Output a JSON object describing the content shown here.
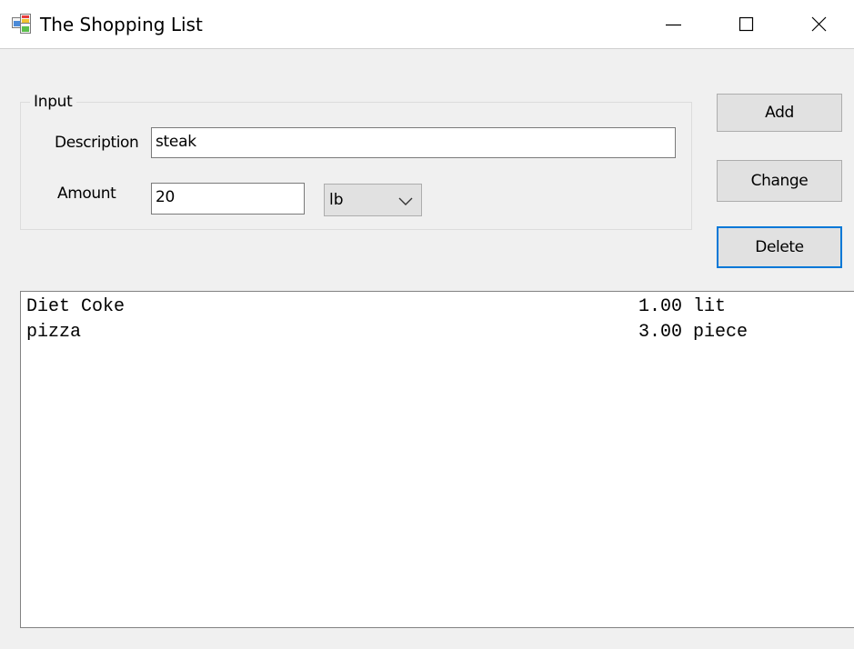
{
  "window": {
    "title": "The Shopping List",
    "app_icon": "winforms-app-icon",
    "controls": {
      "minimize_icon": "minimize-icon",
      "maximize_icon": "maximize-icon",
      "close_icon": "close-icon"
    }
  },
  "input_group": {
    "legend": "Input",
    "description_label": "Description",
    "description_value": "steak",
    "amount_label": "Amount",
    "amount_value": "20",
    "unit_selected": "lb",
    "unit_dropdown_icon": "chevron-down-icon"
  },
  "buttons": {
    "add": "Add",
    "change": "Change",
    "delete": "Delete"
  },
  "list": {
    "items": [
      {
        "description": "Diet Coke",
        "amount": "1.00 lit"
      },
      {
        "description": "pizza",
        "amount": "3.00 piece"
      }
    ]
  },
  "colors": {
    "focus_border": "#0078d7",
    "window_bg": "#f0f0f0",
    "button_bg": "#e1e1e1"
  }
}
